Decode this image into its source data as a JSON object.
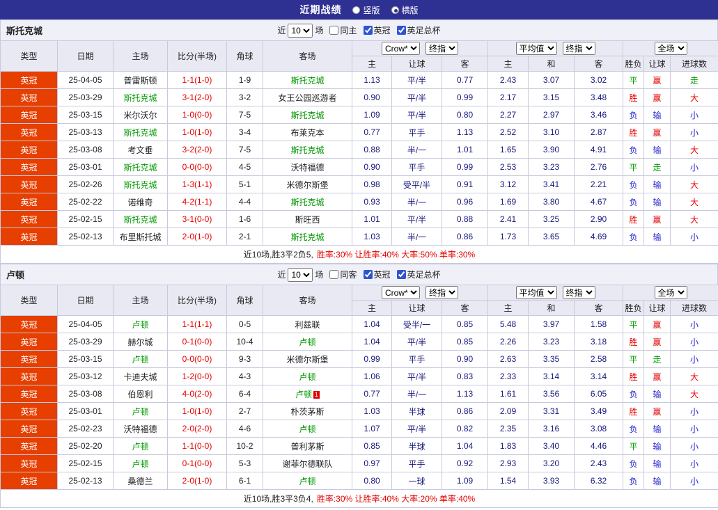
{
  "topbar": {
    "title": "近期战绩",
    "radios": [
      {
        "label": "竖版",
        "selected": false
      },
      {
        "label": "横版",
        "selected": true
      }
    ]
  },
  "colors": {
    "topbar_bg": "#2e3092",
    "league_badge_bg": "#e63f00",
    "focus_team": "#009900",
    "score": "#e60000",
    "win": "#e60000",
    "loss": "#2323cc",
    "draw": "#009900"
  },
  "color_map": {
    "胜": "red",
    "负": "blue",
    "平": "green",
    "赢": "red",
    "输": "blue",
    "走": "green",
    "大": "red",
    "小": "blue"
  },
  "table_header": {
    "group_cols": [
      "类型",
      "日期",
      "主场",
      "比分(半场)",
      "角球",
      "客场"
    ],
    "sub_cols_asian": [
      "主",
      "让球",
      "客"
    ],
    "sub_cols_euro": [
      "主",
      "和",
      "客"
    ],
    "sub_cols_result": [
      "胜负",
      "让球",
      "进球数"
    ]
  },
  "sections": [
    {
      "team": "斯托克城",
      "filters": {
        "near": "近",
        "count": "10",
        "unit": "场",
        "checkboxes": [
          {
            "label": "同主",
            "checked": false
          },
          {
            "label": "英冠",
            "checked": true
          },
          {
            "label": "英足总杯",
            "checked": true
          }
        ]
      },
      "selects": {
        "asian_source": "Crow*",
        "asian_time": "终指",
        "euro_source": "平均值",
        "euro_time": "终指",
        "scope": "全场"
      },
      "rows": [
        {
          "league": "英冠",
          "date": "25-04-05",
          "home": "普雷斯顿",
          "score": "1-1(1-0)",
          "corners": "1-9",
          "away": "斯托克城",
          "ah": [
            "1.13",
            "平/半",
            "0.77"
          ],
          "eu": [
            "2.43",
            "3.07",
            "3.02"
          ],
          "res": [
            "平",
            "赢",
            "走"
          ]
        },
        {
          "league": "英冠",
          "date": "25-03-29",
          "home": "斯托克城",
          "score": "3-1(2-0)",
          "corners": "3-2",
          "away": "女王公园巡游者",
          "ah": [
            "0.90",
            "平/半",
            "0.99"
          ],
          "eu": [
            "2.17",
            "3.15",
            "3.48"
          ],
          "res": [
            "胜",
            "赢",
            "大"
          ]
        },
        {
          "league": "英冠",
          "date": "25-03-15",
          "home": "米尔沃尔",
          "score": "1-0(0-0)",
          "corners": "7-5",
          "away": "斯托克城",
          "ah": [
            "1.09",
            "平/半",
            "0.80"
          ],
          "eu": [
            "2.27",
            "2.97",
            "3.46"
          ],
          "res": [
            "负",
            "输",
            "小"
          ]
        },
        {
          "league": "英冠",
          "date": "25-03-13",
          "home": "斯托克城",
          "score": "1-0(1-0)",
          "corners": "3-4",
          "away": "布莱克本",
          "ah": [
            "0.77",
            "平手",
            "1.13"
          ],
          "eu": [
            "2.52",
            "3.10",
            "2.87"
          ],
          "res": [
            "胜",
            "赢",
            "小"
          ]
        },
        {
          "league": "英冠",
          "date": "25-03-08",
          "home": "考文垂",
          "score": "3-2(2-0)",
          "corners": "7-5",
          "away": "斯托克城",
          "ah": [
            "0.88",
            "半/一",
            "1.01"
          ],
          "eu": [
            "1.65",
            "3.90",
            "4.91"
          ],
          "res": [
            "负",
            "输",
            "大"
          ]
        },
        {
          "league": "英冠",
          "date": "25-03-01",
          "home": "斯托克城",
          "score": "0-0(0-0)",
          "corners": "4-5",
          "away": "沃特福德",
          "ah": [
            "0.90",
            "平手",
            "0.99"
          ],
          "eu": [
            "2.53",
            "3.23",
            "2.76"
          ],
          "res": [
            "平",
            "走",
            "小"
          ]
        },
        {
          "league": "英冠",
          "date": "25-02-26",
          "home": "斯托克城",
          "score": "1-3(1-1)",
          "corners": "5-1",
          "away": "米德尔斯堡",
          "ah": [
            "0.98",
            "受平/半",
            "0.91"
          ],
          "eu": [
            "3.12",
            "3.41",
            "2.21"
          ],
          "res": [
            "负",
            "输",
            "大"
          ]
        },
        {
          "league": "英冠",
          "date": "25-02-22",
          "home": "诺维奇",
          "score": "4-2(1-1)",
          "corners": "4-4",
          "away": "斯托克城",
          "ah": [
            "0.93",
            "半/一",
            "0.96"
          ],
          "eu": [
            "1.69",
            "3.80",
            "4.67"
          ],
          "res": [
            "负",
            "输",
            "大"
          ]
        },
        {
          "league": "英冠",
          "date": "25-02-15",
          "home": "斯托克城",
          "score": "3-1(0-0)",
          "corners": "1-6",
          "away": "斯旺西",
          "ah": [
            "1.01",
            "平/半",
            "0.88"
          ],
          "eu": [
            "2.41",
            "3.25",
            "2.90"
          ],
          "res": [
            "胜",
            "赢",
            "大"
          ]
        },
        {
          "league": "英冠",
          "date": "25-02-13",
          "home": "布里斯托城",
          "score": "2-0(1-0)",
          "corners": "2-1",
          "away": "斯托克城",
          "ah": [
            "1.03",
            "半/一",
            "0.86"
          ],
          "eu": [
            "1.73",
            "3.65",
            "4.69"
          ],
          "res": [
            "负",
            "输",
            "小"
          ]
        }
      ],
      "summary": {
        "prefix": "近10场,胜3平2负5,",
        "stats": "胜率:30% 让胜率:40% 大率:50% 单率:30%"
      }
    },
    {
      "team": "卢顿",
      "filters": {
        "near": "近",
        "count": "10",
        "unit": "场",
        "checkboxes": [
          {
            "label": "同客",
            "checked": false
          },
          {
            "label": "英冠",
            "checked": true
          },
          {
            "label": "英足总杯",
            "checked": true
          }
        ]
      },
      "selects": {
        "asian_source": "Crow*",
        "asian_time": "终指",
        "euro_source": "平均值",
        "euro_time": "终指",
        "scope": "全场"
      },
      "rows": [
        {
          "league": "英冠",
          "date": "25-04-05",
          "home": "卢顿",
          "score": "1-1(1-1)",
          "corners": "0-5",
          "away": "利兹联",
          "ah": [
            "1.04",
            "受半/一",
            "0.85"
          ],
          "eu": [
            "5.48",
            "3.97",
            "1.58"
          ],
          "res": [
            "平",
            "赢",
            "小"
          ]
        },
        {
          "league": "英冠",
          "date": "25-03-29",
          "home": "赫尔城",
          "score": "0-1(0-0)",
          "corners": "10-4",
          "away": "卢顿",
          "ah": [
            "1.04",
            "平/半",
            "0.85"
          ],
          "eu": [
            "2.26",
            "3.23",
            "3.18"
          ],
          "res": [
            "胜",
            "赢",
            "小"
          ]
        },
        {
          "league": "英冠",
          "date": "25-03-15",
          "home": "卢顿",
          "score": "0-0(0-0)",
          "corners": "9-3",
          "away": "米德尔斯堡",
          "ah": [
            "0.99",
            "平手",
            "0.90"
          ],
          "eu": [
            "2.63",
            "3.35",
            "2.58"
          ],
          "res": [
            "平",
            "走",
            "小"
          ]
        },
        {
          "league": "英冠",
          "date": "25-03-12",
          "home": "卡迪夫城",
          "score": "1-2(0-0)",
          "corners": "4-3",
          "away": "卢顿",
          "ah": [
            "1.06",
            "平/半",
            "0.83"
          ],
          "eu": [
            "2.33",
            "3.14",
            "3.14"
          ],
          "res": [
            "胜",
            "赢",
            "大"
          ]
        },
        {
          "league": "英冠",
          "date": "25-03-08",
          "home": "伯恩利",
          "score": "4-0(2-0)",
          "corners": "6-4",
          "away": "卢顿",
          "away_badge": "1",
          "ah": [
            "0.77",
            "半/一",
            "1.13"
          ],
          "eu": [
            "1.61",
            "3.56",
            "6.05"
          ],
          "res": [
            "负",
            "输",
            "大"
          ]
        },
        {
          "league": "英冠",
          "date": "25-03-01",
          "home": "卢顿",
          "score": "1-0(1-0)",
          "corners": "2-7",
          "away": "朴茨茅斯",
          "ah": [
            "1.03",
            "半球",
            "0.86"
          ],
          "eu": [
            "2.09",
            "3.31",
            "3.49"
          ],
          "res": [
            "胜",
            "赢",
            "小"
          ]
        },
        {
          "league": "英冠",
          "date": "25-02-23",
          "home": "沃特福德",
          "score": "2-0(2-0)",
          "corners": "4-6",
          "away": "卢顿",
          "ah": [
            "1.07",
            "平/半",
            "0.82"
          ],
          "eu": [
            "2.35",
            "3.16",
            "3.08"
          ],
          "res": [
            "负",
            "输",
            "小"
          ]
        },
        {
          "league": "英冠",
          "date": "25-02-20",
          "home": "卢顿",
          "score": "1-1(0-0)",
          "corners": "10-2",
          "away": "普利茅斯",
          "ah": [
            "0.85",
            "半球",
            "1.04"
          ],
          "eu": [
            "1.83",
            "3.40",
            "4.46"
          ],
          "res": [
            "平",
            "输",
            "小"
          ]
        },
        {
          "league": "英冠",
          "date": "25-02-15",
          "home": "卢顿",
          "score": "0-1(0-0)",
          "corners": "5-3",
          "away": "谢菲尔德联队",
          "ah": [
            "0.97",
            "平手",
            "0.92"
          ],
          "eu": [
            "2.93",
            "3.20",
            "2.43"
          ],
          "res": [
            "负",
            "输",
            "小"
          ]
        },
        {
          "league": "英冠",
          "date": "25-02-13",
          "home": "桑德兰",
          "score": "2-0(1-0)",
          "corners": "6-1",
          "away": "卢顿",
          "ah": [
            "0.80",
            "一球",
            "1.09"
          ],
          "eu": [
            "1.54",
            "3.93",
            "6.32"
          ],
          "res": [
            "负",
            "输",
            "小"
          ]
        }
      ],
      "summary": {
        "prefix": "近10场,胜3平3负4,",
        "stats": "胜率:30% 让胜率:40% 大率:20% 单率:40%"
      }
    }
  ]
}
